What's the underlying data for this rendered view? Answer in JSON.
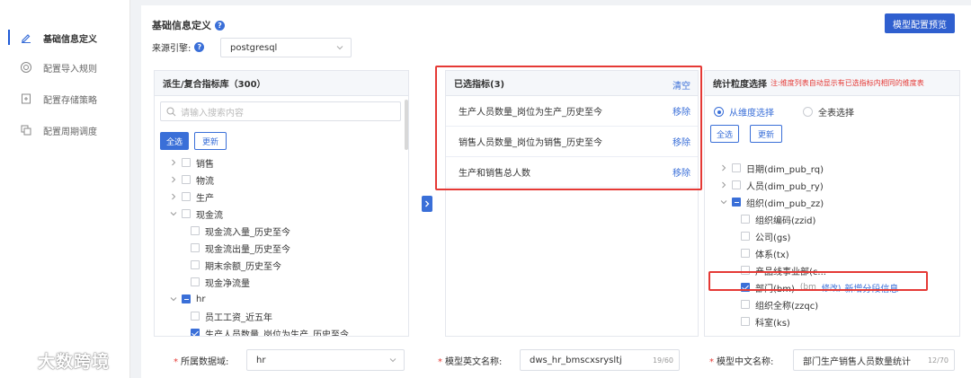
{
  "sidebar": {
    "items": [
      {
        "label": "基础信息定义",
        "icon": "edit-icon",
        "active": true
      },
      {
        "label": "配置导入规则",
        "icon": "target-icon"
      },
      {
        "label": "配置存储策略",
        "icon": "storage-icon"
      },
      {
        "label": "配置周期调度",
        "icon": "copy-icon"
      }
    ]
  },
  "watermark": "大数跨境",
  "header": {
    "title": "基础信息定义",
    "preview_button": "模型配置预览",
    "engine_label": "来源引擎:",
    "engine_value": "postgresql"
  },
  "library": {
    "title": "派生/复合指标库（300）",
    "search_placeholder": "请输入搜索内容",
    "select_all": "全选",
    "refresh": "更新",
    "tree": [
      {
        "label": "销售",
        "level": 0,
        "expanded": false,
        "checked": false
      },
      {
        "label": "物流",
        "level": 0,
        "expanded": false,
        "checked": false
      },
      {
        "label": "生产",
        "level": 0,
        "expanded": false,
        "checked": false
      },
      {
        "label": "现金流",
        "level": 0,
        "expanded": true,
        "checked": false
      },
      {
        "label": "现金流入量_历史至今",
        "level": 1,
        "checked": false
      },
      {
        "label": "现金流出量_历史至今",
        "level": 1,
        "checked": false
      },
      {
        "label": "期末余额_历史至今",
        "level": 1,
        "checked": false
      },
      {
        "label": "现金净流量",
        "level": 1,
        "checked": false
      },
      {
        "label": "hr",
        "level": 0,
        "expanded": true,
        "checked": "indeterminate"
      },
      {
        "label": "员工工资_近五年",
        "level": 1,
        "checked": false
      },
      {
        "label": "生产人员数量_岗位为生产_历史至今",
        "level": 1,
        "checked": true
      }
    ]
  },
  "selected": {
    "title": "已选指标(3)",
    "clear": "清空",
    "remove_label": "移除",
    "items": [
      "生产人员数量_岗位为生产_历史至今",
      "销售人员数量_岗位为销售_历史至今",
      "生产和销售总人数"
    ]
  },
  "granularity": {
    "title": "统计粒度选择",
    "note": "注:维度列表自动显示有已选指标内相同的维度表",
    "radio_dimension": "从维度选择",
    "radio_table": "全表选择",
    "select_all": "全选",
    "refresh": "更新",
    "tree": [
      {
        "label": "日期(dim_pub_rq)",
        "level": 0,
        "expanded": false,
        "checked": false
      },
      {
        "label": "人员(dim_pub_ry)",
        "level": 0,
        "expanded": false,
        "checked": false
      },
      {
        "label": "组织(dim_pub_zz)",
        "level": 0,
        "expanded": true,
        "checked": "indeterminate"
      },
      {
        "label": "组织编码(zzid)",
        "level": 1,
        "checked": false
      },
      {
        "label": "公司(gs)",
        "level": 1,
        "checked": false
      },
      {
        "label": "体系(tx)",
        "level": 1,
        "checked": false
      },
      {
        "label": "产品线事业部(c...",
        "level": 1,
        "checked": false
      },
      {
        "label": "部门(bm)",
        "level": 1,
        "checked": true
      },
      {
        "label": "组织全称(zzqc)",
        "level": 1,
        "checked": false
      },
      {
        "label": "科室(ks)",
        "level": 1,
        "checked": false
      }
    ],
    "dept_hint": "(bm",
    "dept_modify": "修改)",
    "dept_new": "新增分段信息"
  },
  "form": {
    "database_label": "所属数据域:",
    "database_value": "hr",
    "en_name_label": "模型英文名称:",
    "en_name_value": "dws_hr_bmscxsrysltj",
    "en_name_count": "19/60",
    "cn_name_label": "模型中文名称:",
    "cn_name_value": "部门生产销售人员数量统计",
    "cn_name_count": "12/70"
  },
  "colors": {
    "primary": "#3a6fd8",
    "highlight": "#e53935"
  }
}
